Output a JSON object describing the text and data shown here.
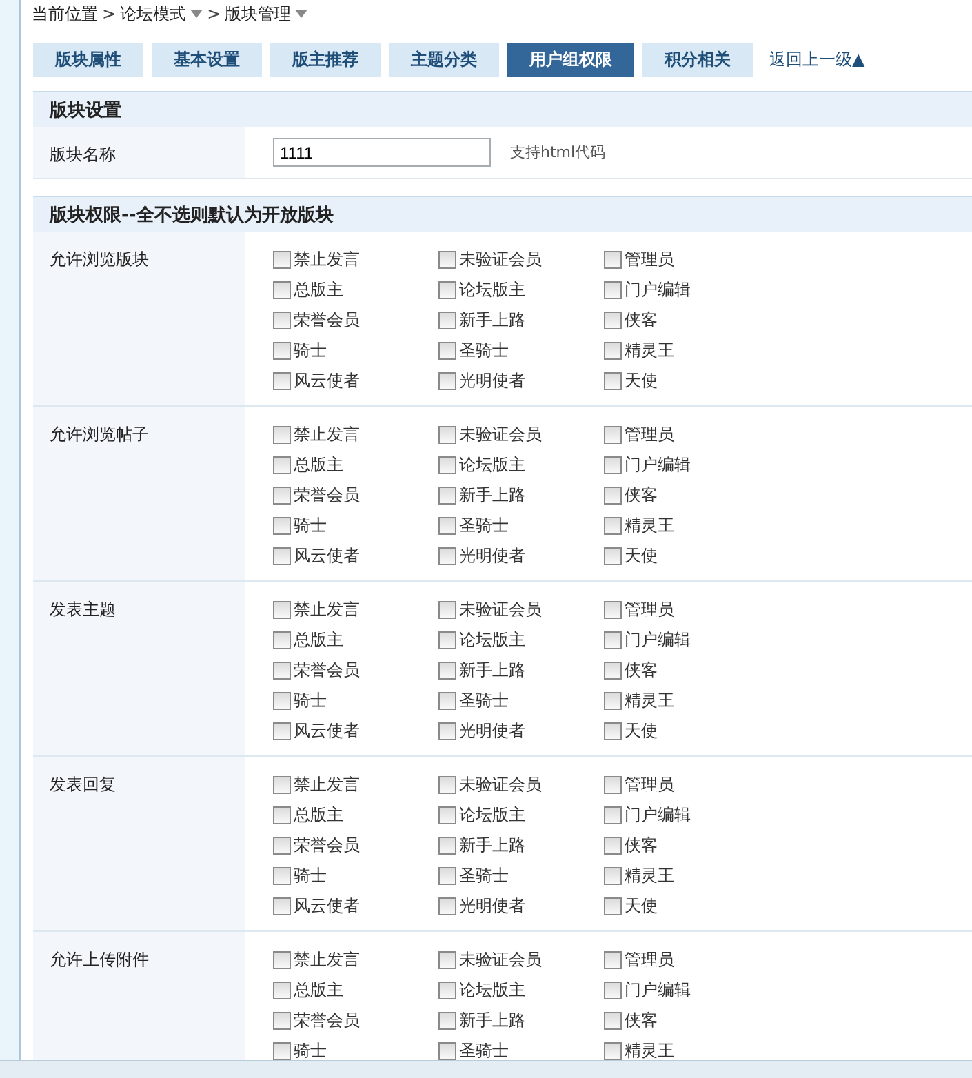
{
  "breadcrumb": [
    {
      "label": "当前位置",
      "dropdown": false
    },
    {
      "separator": ">",
      "label": "论坛模式",
      "dropdown": true
    },
    {
      "separator": ">",
      "label": "版块管理",
      "dropdown": true
    }
  ],
  "tabs": [
    {
      "label": "版块属性",
      "selected": false
    },
    {
      "label": "基本设置",
      "selected": false
    },
    {
      "label": "版主推荐",
      "selected": false
    },
    {
      "label": "主题分类",
      "selected": false
    },
    {
      "label": "用户组权限",
      "selected": true
    },
    {
      "label": "积分相关",
      "selected": false
    }
  ],
  "back_link": "返回上一级▲",
  "settings": {
    "title": "版块设置",
    "label": "版块名称",
    "value": "1111",
    "hint": "支持html代码"
  },
  "permissions": {
    "title": "版块权限--全不选则默认为开放版块",
    "groups": [
      {
        "label": "允许浏览版块",
        "options": [
          {
            "label": "禁止发言",
            "checked": false
          },
          {
            "label": "未验证会员",
            "checked": false
          },
          {
            "label": "管理员",
            "checked": false
          },
          {
            "label": "总版主",
            "checked": false
          },
          {
            "label": "论坛版主",
            "checked": false
          },
          {
            "label": "门户编辑",
            "checked": false
          },
          {
            "label": "荣誉会员",
            "checked": false
          },
          {
            "label": "新手上路",
            "checked": false
          },
          {
            "label": "侠客",
            "checked": false
          },
          {
            "label": "骑士",
            "checked": false
          },
          {
            "label": "圣骑士",
            "checked": false
          },
          {
            "label": "精灵王",
            "checked": false
          },
          {
            "label": "风云使者",
            "checked": false
          },
          {
            "label": "光明使者",
            "checked": false
          },
          {
            "label": "天使",
            "checked": false
          }
        ]
      },
      {
        "label": "允许浏览帖子",
        "options": [
          {
            "label": "禁止发言",
            "checked": false
          },
          {
            "label": "未验证会员",
            "checked": false
          },
          {
            "label": "管理员",
            "checked": false
          },
          {
            "label": "总版主",
            "checked": false
          },
          {
            "label": "论坛版主",
            "checked": false
          },
          {
            "label": "门户编辑",
            "checked": false
          },
          {
            "label": "荣誉会员",
            "checked": false
          },
          {
            "label": "新手上路",
            "checked": false
          },
          {
            "label": "侠客",
            "checked": false
          },
          {
            "label": "骑士",
            "checked": false
          },
          {
            "label": "圣骑士",
            "checked": false
          },
          {
            "label": "精灵王",
            "checked": false
          },
          {
            "label": "风云使者",
            "checked": false
          },
          {
            "label": "光明使者",
            "checked": false
          },
          {
            "label": "天使",
            "checked": false
          }
        ]
      },
      {
        "label": "发表主题",
        "options": [
          {
            "label": "禁止发言",
            "checked": false
          },
          {
            "label": "未验证会员",
            "checked": false
          },
          {
            "label": "管理员",
            "checked": false
          },
          {
            "label": "总版主",
            "checked": false
          },
          {
            "label": "论坛版主",
            "checked": false
          },
          {
            "label": "门户编辑",
            "checked": false
          },
          {
            "label": "荣誉会员",
            "checked": false
          },
          {
            "label": "新手上路",
            "checked": false
          },
          {
            "label": "侠客",
            "checked": false
          },
          {
            "label": "骑士",
            "checked": false
          },
          {
            "label": "圣骑士",
            "checked": false
          },
          {
            "label": "精灵王",
            "checked": false
          },
          {
            "label": "风云使者",
            "checked": false
          },
          {
            "label": "光明使者",
            "checked": false
          },
          {
            "label": "天使",
            "checked": false
          }
        ]
      },
      {
        "label": "发表回复",
        "options": [
          {
            "label": "禁止发言",
            "checked": false
          },
          {
            "label": "未验证会员",
            "checked": false
          },
          {
            "label": "管理员",
            "checked": false
          },
          {
            "label": "总版主",
            "checked": false
          },
          {
            "label": "论坛版主",
            "checked": false
          },
          {
            "label": "门户编辑",
            "checked": false
          },
          {
            "label": "荣誉会员",
            "checked": false
          },
          {
            "label": "新手上路",
            "checked": false
          },
          {
            "label": "侠客",
            "checked": false
          },
          {
            "label": "骑士",
            "checked": false
          },
          {
            "label": "圣骑士",
            "checked": false
          },
          {
            "label": "精灵王",
            "checked": false
          },
          {
            "label": "风云使者",
            "checked": false
          },
          {
            "label": "光明使者",
            "checked": false
          },
          {
            "label": "天使",
            "checked": false
          }
        ]
      },
      {
        "label": "允许上传附件",
        "options": [
          {
            "label": "禁止发言",
            "checked": false
          },
          {
            "label": "未验证会员",
            "checked": false
          },
          {
            "label": "管理员",
            "checked": false
          },
          {
            "label": "总版主",
            "checked": false
          },
          {
            "label": "论坛版主",
            "checked": false
          },
          {
            "label": "门户编辑",
            "checked": false
          },
          {
            "label": "荣誉会员",
            "checked": false
          },
          {
            "label": "新手上路",
            "checked": false
          },
          {
            "label": "侠客",
            "checked": false
          },
          {
            "label": "骑士",
            "checked": false
          },
          {
            "label": "圣骑士",
            "checked": false
          },
          {
            "label": "精灵王",
            "checked": false
          }
        ]
      }
    ]
  }
}
